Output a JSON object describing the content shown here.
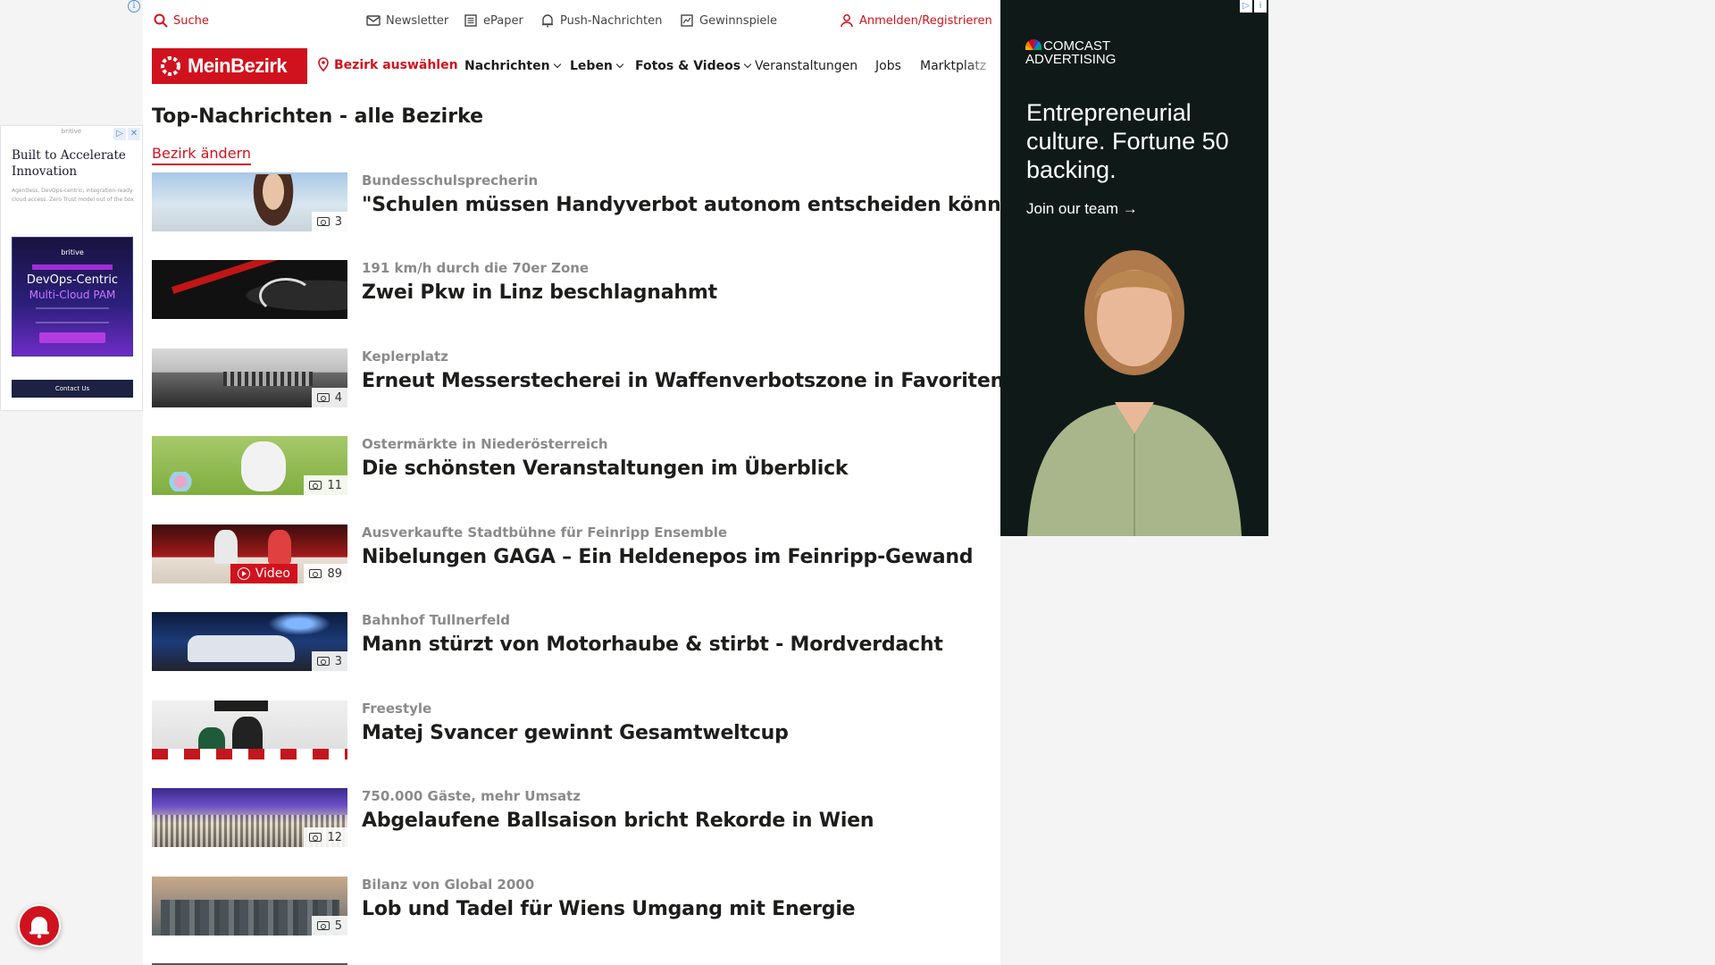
{
  "topbar": {
    "search": "Suche",
    "newsletter": "Newsletter",
    "epaper": "ePaper",
    "push": "Push-Nachrichten",
    "contests": "Gewinnspiele",
    "login": "Anmelden/Registrieren"
  },
  "nav": {
    "logo": "MeinBezirk",
    "select_district": "Bezirk auswählen",
    "items": [
      "Nachrichten",
      "Leben",
      "Fotos & Videos",
      "Veranstaltungen",
      "Jobs",
      "Marktplatz"
    ]
  },
  "page": {
    "title": "Top-Nachrichten - alle Bezirke",
    "change_district": "Bezirk ändern"
  },
  "articles": [
    {
      "kicker": "Bundesschulsprecherin",
      "headline": "\"Schulen müssen Handyverbot autonom entscheiden können\"",
      "images": "3"
    },
    {
      "kicker": "191 km/h durch die 70er Zone",
      "headline": "Zwei Pkw in Linz beschlagnahmt",
      "images": ""
    },
    {
      "kicker": "Keplerplatz",
      "headline": "Erneut Messerstecherei in Waffenverbotszone in Favoriten",
      "images": "4"
    },
    {
      "kicker": "Ostermärkte in Niederösterreich",
      "headline": "Die schönsten Veranstaltungen im Überblick",
      "images": "11"
    },
    {
      "kicker": "Ausverkaufte Stadtbühne für Feinripp Ensemble",
      "headline": "Nibelungen GAGA – Ein Heldenepos im Feinripp-Gewand",
      "images": "89",
      "video": "Video"
    },
    {
      "kicker": "Bahnhof Tullnerfeld",
      "headline": "Mann stürzt von Motorhaube & stirbt - Mordverdacht",
      "images": "3"
    },
    {
      "kicker": "Freestyle",
      "headline": "Matej Svancer gewinnt Gesamtweltcup",
      "images": ""
    },
    {
      "kicker": "750.000 Gäste, mehr Umsatz",
      "headline": "Abgelaufene Ballsaison bricht Rekorde in Wien",
      "images": "12"
    },
    {
      "kicker": "Bilanz von Global 2000",
      "headline": "Lob und Tadel für Wiens Umgang mit Energie",
      "images": "5"
    }
  ],
  "left_ad": {
    "brand": "britive",
    "headline": "Built to Accelerate Innovation",
    "sub": "Agentless, DevOps-centric, integration-ready cloud access. Zero Trust model out of the box",
    "promo_brand": "britive",
    "promo_line1": "DevOps-Centric",
    "promo_line2": "Multi-Cloud PAM",
    "cta": "Contact Us"
  },
  "right_ad": {
    "brand_line1": "COMCAST",
    "brand_line2": "ADVERTISING",
    "headline": "Entrepreneurial culture. Fortune 50 backing.",
    "cta": "Join our team →"
  },
  "colors": {
    "brand_red": "#d0121e",
    "text": "#1d1d1b",
    "kicker": "#8a8a8a"
  }
}
